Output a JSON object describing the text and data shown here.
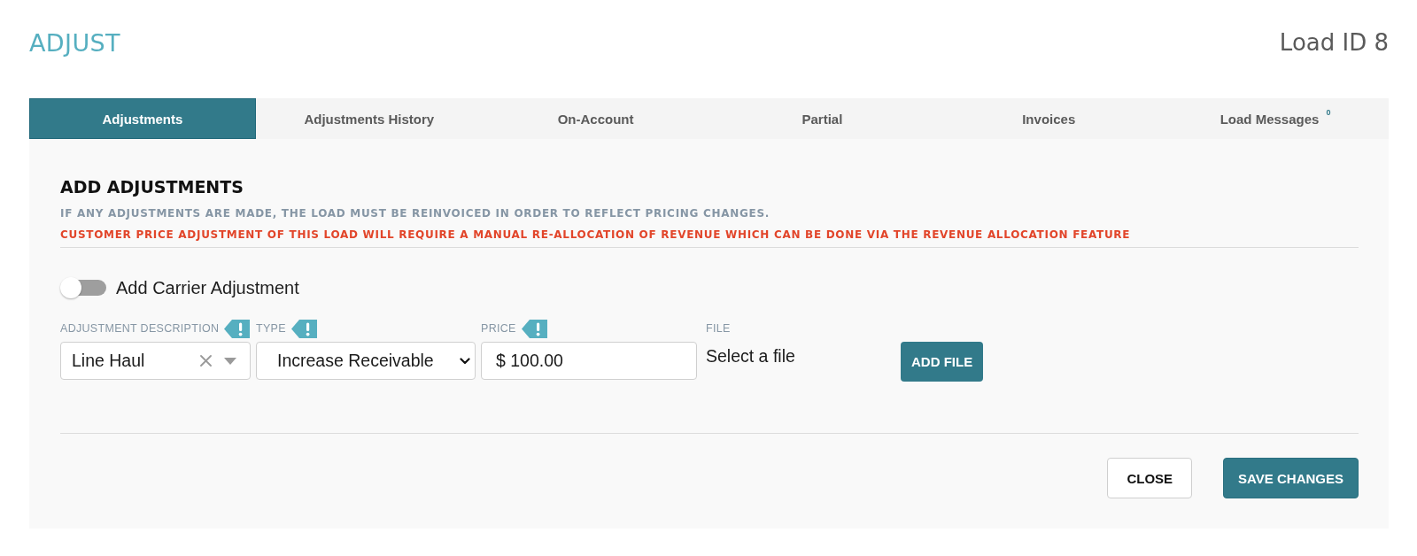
{
  "header": {
    "title": "ADJUST",
    "load_id": "Load ID 8"
  },
  "tabs": [
    {
      "label": "Adjustments",
      "selected": true
    },
    {
      "label": "Adjustments History",
      "selected": false
    },
    {
      "label": "On-Account",
      "selected": false
    },
    {
      "label": "Partial",
      "selected": false
    },
    {
      "label": "Invoices",
      "selected": false
    },
    {
      "label": "Load Messages",
      "selected": false,
      "badge": "0"
    }
  ],
  "section": {
    "title": "ADD ADJUSTMENTS",
    "notice": "IF ANY ADJUSTMENTS ARE MADE, THE LOAD MUST BE REINVOICED IN ORDER TO REFLECT PRICING CHANGES.",
    "warning": "CUSTOMER PRICE ADJUSTMENT OF THIS LOAD WILL REQUIRE A MANUAL RE-ALLOCATION OF REVENUE WHICH CAN BE DONE VIA THE REVENUE ALLOCATION FEATURE"
  },
  "carrier_toggle": {
    "label": "Add Carrier Adjustment",
    "on": false
  },
  "fields": [
    {
      "kind": "combo",
      "label": "ADJUSTMENT DESCRIPTION",
      "alert": true,
      "value": "Line Haul"
    },
    {
      "kind": "select",
      "label": "TYPE",
      "alert": true,
      "value": "Increase Receivable"
    },
    {
      "kind": "text",
      "label": "PRICE",
      "alert": true,
      "value": "$ 100.00"
    },
    {
      "kind": "file",
      "label": "FILE",
      "alert": false,
      "status": "Select a file",
      "button": "ADD FILE"
    }
  ],
  "buttons": [
    {
      "kind": "secondary",
      "label": "CLOSE"
    },
    {
      "kind": "primary",
      "label": "SAVE CHANGES"
    }
  ]
}
